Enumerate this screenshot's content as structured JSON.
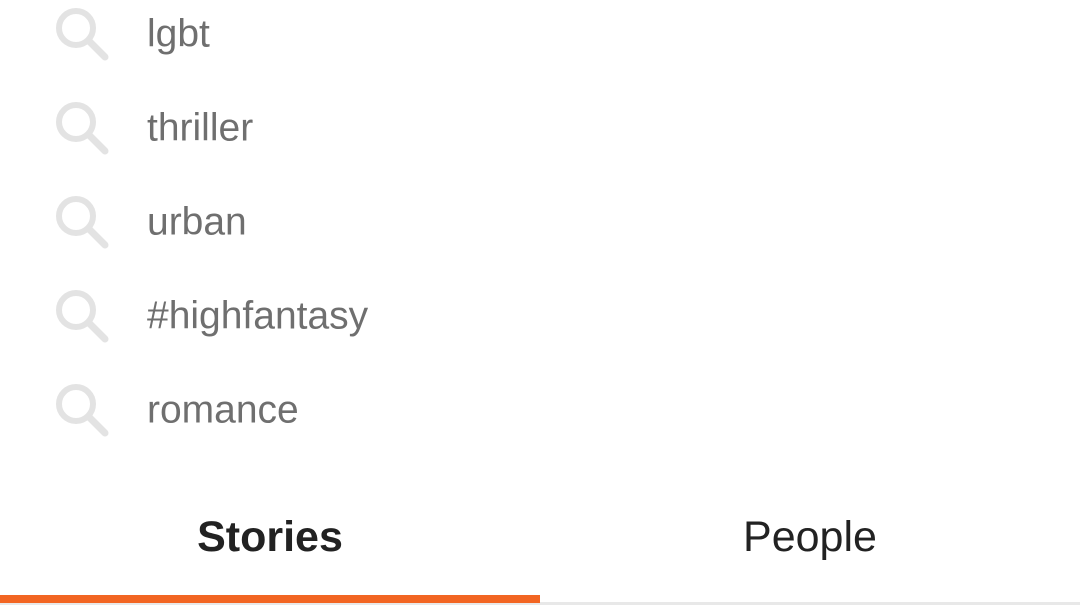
{
  "search_suggestions": [
    {
      "label": "lgbt",
      "icon": "search-icon"
    },
    {
      "label": "thriller",
      "icon": "search-icon"
    },
    {
      "label": "urban",
      "icon": "search-icon"
    },
    {
      "label": "#highfantasy",
      "icon": "search-icon"
    },
    {
      "label": "romance",
      "icon": "search-icon"
    }
  ],
  "tabs": [
    {
      "label": "Stories",
      "selected": true
    },
    {
      "label": "People",
      "selected": false
    }
  ],
  "colors": {
    "accent": "#f26522",
    "icon": "#e3e3e3",
    "suggestion_text": "#6f6f6f",
    "tab_text": "#222222"
  }
}
